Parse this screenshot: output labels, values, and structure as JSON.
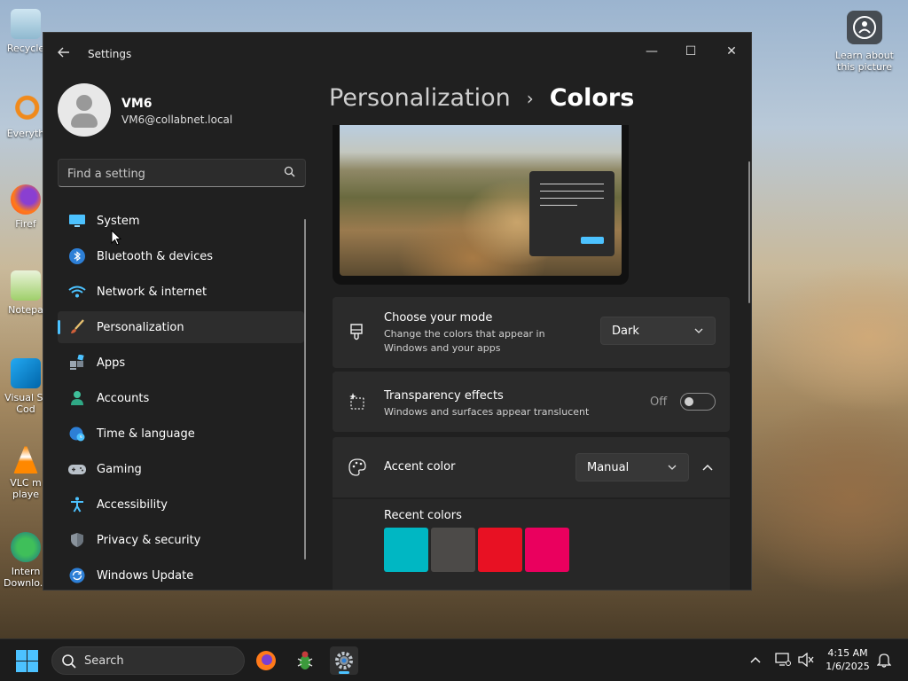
{
  "desktop": {
    "icons": [
      {
        "label": "Recycle"
      },
      {
        "label": "Everyth"
      },
      {
        "label": "Firef"
      },
      {
        "label": "Notepa"
      },
      {
        "label": "Visual St Cod"
      },
      {
        "label": "VLC m playe"
      },
      {
        "label": "Intern Downlo..."
      }
    ],
    "learn_label": "Learn about this picture"
  },
  "window": {
    "title": "Settings",
    "controls": {
      "minimize": "—",
      "maximize": "☐",
      "close": "✕"
    }
  },
  "user": {
    "name": "VM6",
    "email": "VM6@collabnet.local"
  },
  "search": {
    "placeholder": "Find a setting"
  },
  "nav": {
    "items": [
      {
        "label": "System",
        "icon": "monitor-icon"
      },
      {
        "label": "Bluetooth & devices",
        "icon": "bluetooth-icon"
      },
      {
        "label": "Network & internet",
        "icon": "wifi-icon"
      },
      {
        "label": "Personalization",
        "icon": "brush-icon",
        "active": true
      },
      {
        "label": "Apps",
        "icon": "apps-icon"
      },
      {
        "label": "Accounts",
        "icon": "person-icon"
      },
      {
        "label": "Time & language",
        "icon": "globe-clock-icon"
      },
      {
        "label": "Gaming",
        "icon": "gamepad-icon"
      },
      {
        "label": "Accessibility",
        "icon": "accessibility-icon"
      },
      {
        "label": "Privacy & security",
        "icon": "shield-icon"
      },
      {
        "label": "Windows Update",
        "icon": "update-icon"
      }
    ]
  },
  "breadcrumb": {
    "parent": "Personalization",
    "separator": "›",
    "current": "Colors"
  },
  "mode": {
    "title": "Choose your mode",
    "subtitle_line1": "Change the colors that appear in",
    "subtitle_line2": "Windows and your apps",
    "value": "Dark"
  },
  "transparency": {
    "title": "Transparency effects",
    "subtitle": "Windows and surfaces appear translucent",
    "state_label": "Off"
  },
  "accent": {
    "title": "Accent color",
    "value": "Manual",
    "recent_label": "Recent colors",
    "recent_colors": [
      "#00b7c3",
      "#4c4a48",
      "#e81123",
      "#ea005e"
    ]
  },
  "colors": {
    "accent": "#4cc2ff",
    "window_bg": "#202020",
    "card_bg": "#2b2b2b"
  },
  "taskbar": {
    "search_label": "Search",
    "time": "4:15 AM",
    "date": "1/6/2025"
  }
}
